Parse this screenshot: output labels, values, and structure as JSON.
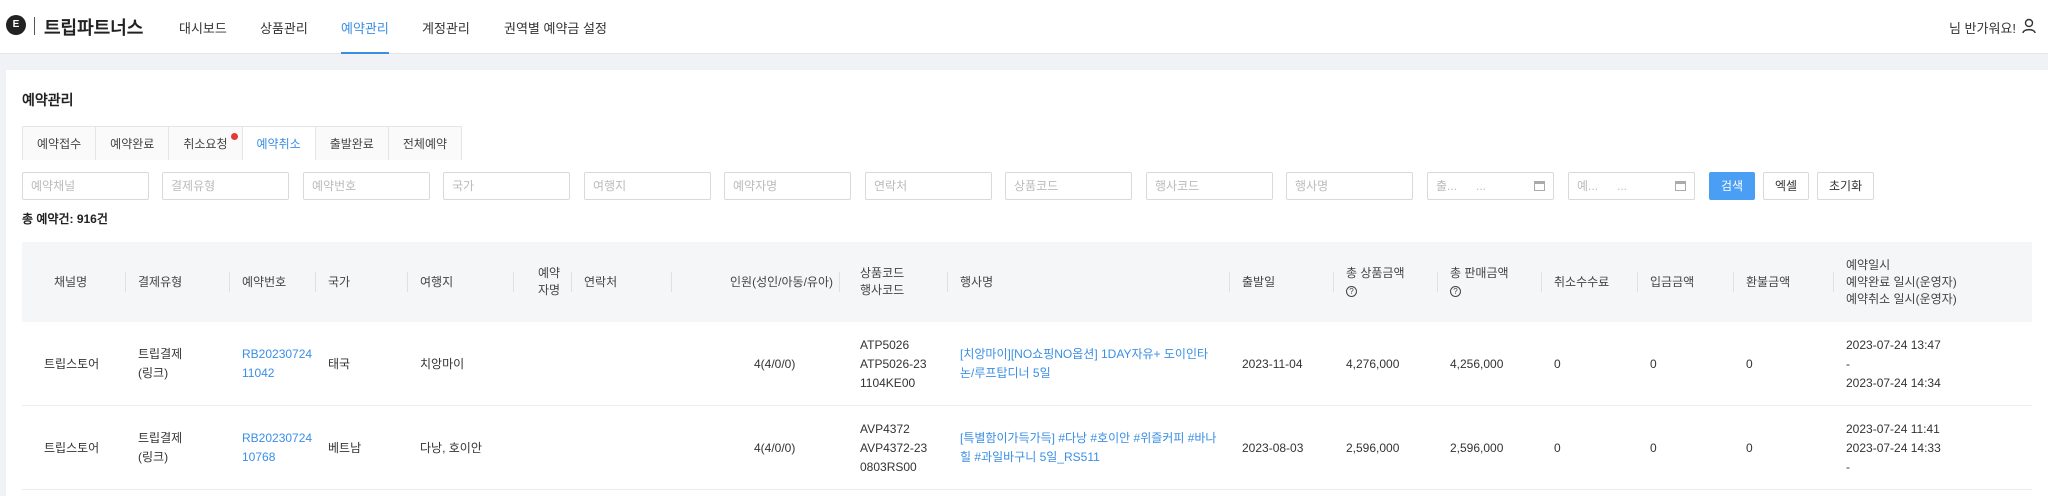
{
  "header": {
    "logo_letter": "E",
    "brand": "트립파트너스",
    "nav": [
      {
        "label": "대시보드"
      },
      {
        "label": "상품관리"
      },
      {
        "label": "예약관리",
        "active": true
      },
      {
        "label": "계정관리"
      },
      {
        "label": "권역별 예약금 설정"
      }
    ],
    "greeting": "님 반가워요!"
  },
  "page": {
    "title": "예약관리",
    "tabs": [
      {
        "label": "예약접수"
      },
      {
        "label": "예약완료"
      },
      {
        "label": "취소요청",
        "has_badge": true
      },
      {
        "label": "예약취소",
        "active": true
      },
      {
        "label": "출발완료"
      },
      {
        "label": "전체예약"
      }
    ],
    "filters": {
      "placeholders": [
        "예약채널",
        "결제유형",
        "예약번호",
        "국가",
        "여행지",
        "예약자명",
        "연락처",
        "상품코드",
        "행사코드",
        "행사명"
      ],
      "date_start": {
        "from": "출...",
        "to": "..."
      },
      "date_end": {
        "from": "예...",
        "to": "..."
      },
      "search_label": "검색",
      "excel_label": "엑셀",
      "reset_label": "초기화"
    },
    "total_label": "총 예약건: 916건"
  },
  "table": {
    "headers": {
      "channel": "채널명",
      "pay_type": "결제유형",
      "res_no": "예약번호",
      "country": "국가",
      "destination": "여행지",
      "booker": "예약자명",
      "contact": "연락처",
      "people": "인원(성인/아동/유아)",
      "codes_1": "상품코드",
      "codes_2": "행사코드",
      "event": "행사명",
      "depart": "출발일",
      "total_product": "총 상품금액",
      "total_sale": "총 판매금액",
      "cancel_fee": "취소수수료",
      "deposit": "입금금액",
      "refund": "환불금액",
      "dates_1": "예약일시",
      "dates_2": "예약완료 일시(운영자)",
      "dates_3": "예약취소 일시(운영자)"
    },
    "rows": [
      {
        "channel": "트립스토어",
        "pay_type": "트립결제(링크)",
        "res_no": "RB2023072411042",
        "country": "태국",
        "destination": "치앙마이",
        "booker": "",
        "contact": "",
        "people": "4(4/0/0)",
        "product_code": "ATP5026",
        "event_code": "ATP5026-231104KE00",
        "event": "[치앙마이][NO쇼핑NO옵션] 1DAY자유+ 도이인타논/루프탑디너 5일",
        "depart": "2023-11-04",
        "total_product": "4,276,000",
        "total_sale": "4,256,000",
        "cancel_fee": "0",
        "deposit": "0",
        "refund": "0",
        "date_1": "2023-07-24 13:47",
        "date_2": "-",
        "date_3": "2023-07-24 14:34"
      },
      {
        "channel": "트립스토어",
        "pay_type": "트립결제(링크)",
        "res_no": "RB2023072410768",
        "country": "베트남",
        "destination": "다낭, 호이안",
        "booker": "",
        "contact": "",
        "people": "4(4/0/0)",
        "product_code": "AVP4372",
        "event_code": "AVP4372-230803RS00",
        "event": "[특별함이가득가득] #다낭 #호이안 #위즐커피 #바나힐 #과일바구니 5일_RS511",
        "depart": "2023-08-03",
        "total_product": "2,596,000",
        "total_sale": "2,596,000",
        "cancel_fee": "0",
        "deposit": "0",
        "refund": "0",
        "date_1": "2023-07-24 11:41",
        "date_2": "2023-07-24 14:33",
        "date_3": "-"
      }
    ]
  }
}
